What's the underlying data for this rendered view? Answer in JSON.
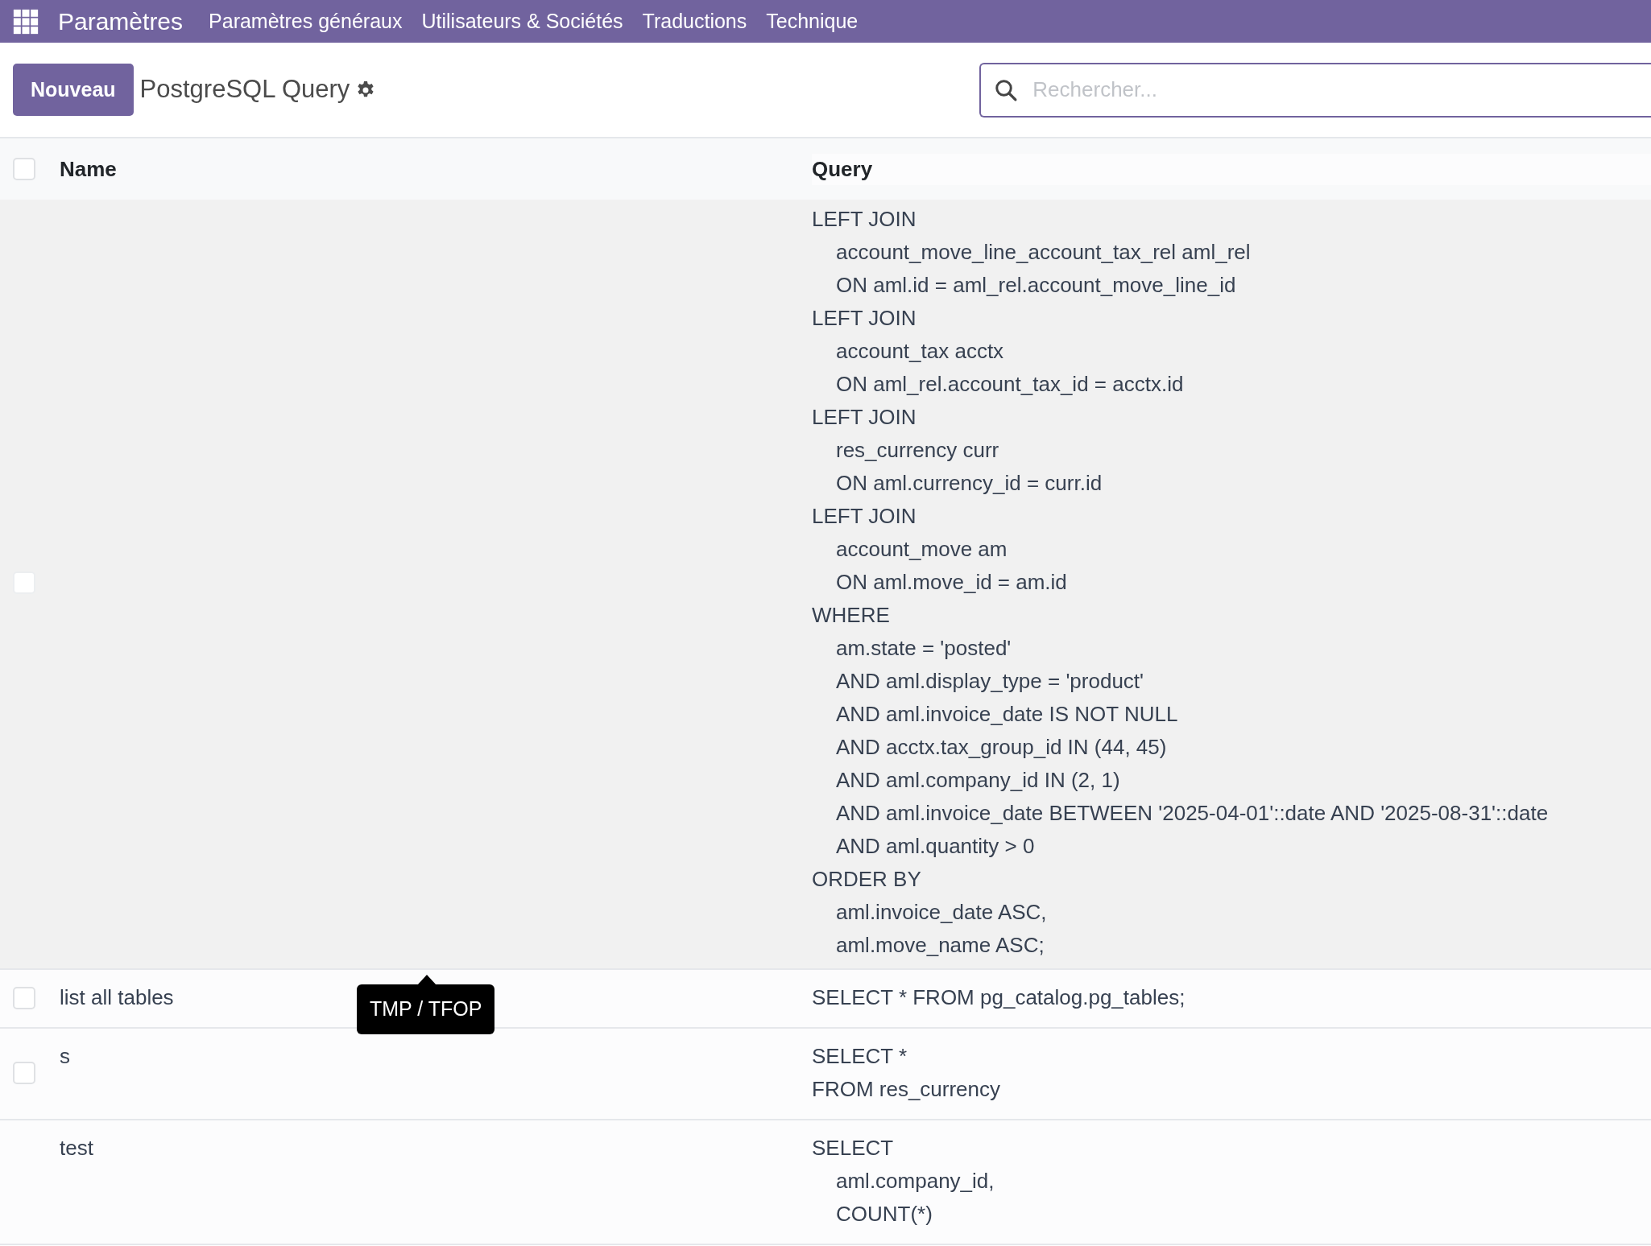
{
  "navbar": {
    "app": "Paramètres",
    "menus": [
      "Paramètres généraux",
      "Utilisateurs & Sociétés",
      "Traductions",
      "Technique"
    ]
  },
  "control_panel": {
    "new_button": "Nouveau",
    "title": "PostgreSQL Query",
    "search": {
      "placeholder": "Rechercher..."
    }
  },
  "table": {
    "columns": [
      "Name",
      "Query"
    ],
    "select_all_checked": false,
    "rows": [
      {
        "name": "",
        "checked": false,
        "highlighted": true,
        "query": [
          {
            "text": "LEFT JOIN",
            "children": [
              "account_move_line_account_tax_rel aml_rel",
              "ON aml.id = aml_rel.account_move_line_id"
            ]
          },
          {
            "text": "LEFT JOIN",
            "children": [
              "account_tax acctx",
              "ON aml_rel.account_tax_id = acctx.id"
            ]
          },
          {
            "text": "LEFT JOIN",
            "children": [
              "res_currency curr",
              "ON aml.currency_id = curr.id"
            ]
          },
          {
            "text": "LEFT JOIN",
            "children": [
              "account_move am",
              "ON aml.move_id = am.id"
            ]
          },
          {
            "text": "WHERE",
            "children": [
              "am.state = 'posted'",
              "AND aml.display_type = 'product'",
              "AND aml.invoice_date IS NOT NULL",
              "AND acctx.tax_group_id IN (44, 45)",
              "AND aml.company_id IN (2, 1)",
              "AND aml.invoice_date BETWEEN '2025-04-01'::date AND '2025-08-31'::date",
              "AND aml.quantity > 0"
            ]
          },
          {
            "text": "ORDER BY",
            "children": [
              "aml.invoice_date ASC,",
              "aml.move_name ASC;"
            ]
          }
        ]
      },
      {
        "name": "list all tables",
        "checked": false,
        "highlighted": false,
        "tooltip": "TMP / TFOP",
        "query": [
          {
            "text": "SELECT * FROM pg_catalog.pg_tables;"
          }
        ]
      },
      {
        "name": "s",
        "checked": false,
        "highlighted": false,
        "query": [
          {
            "text": "SELECT *"
          },
          {
            "text": "FROM res_currency"
          }
        ]
      },
      {
        "name": "test",
        "highlighted": false,
        "query": [
          {
            "text": "SELECT",
            "children": [
              "aml.company_id,",
              "COUNT(*)"
            ]
          }
        ]
      }
    ]
  }
}
